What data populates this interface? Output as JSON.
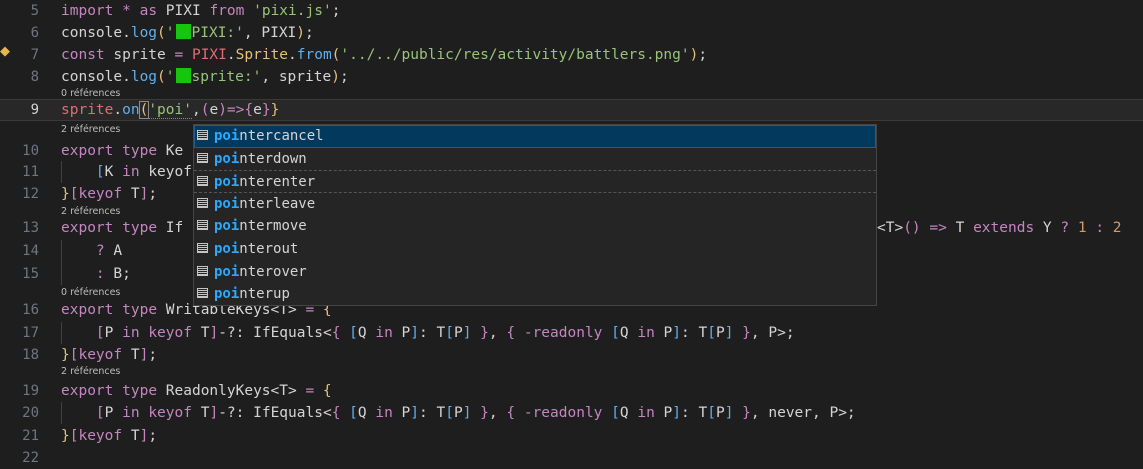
{
  "editor": {
    "lines": [
      {
        "num": "5",
        "tokens": [
          [
            "kw",
            "import"
          ],
          [
            "plain",
            " "
          ],
          [
            "kw",
            "*"
          ],
          [
            "plain",
            " "
          ],
          [
            "kw",
            "as"
          ],
          [
            "plain",
            " PIXI "
          ],
          [
            "kw",
            "from"
          ],
          [
            "plain",
            " "
          ],
          [
            "str",
            "'pixi.js'"
          ],
          [
            "plain",
            ";"
          ]
        ]
      },
      {
        "num": "6",
        "tokens": [
          [
            "plain",
            "console"
          ],
          [
            "plain",
            "."
          ],
          [
            "fn",
            "log"
          ],
          [
            "br1",
            "("
          ],
          [
            "str",
            "'"
          ],
          [
            "sq",
            ""
          ],
          [
            "str",
            "PIXI:'"
          ],
          [
            "plain",
            ", PIXI"
          ],
          [
            "br1",
            ")"
          ],
          [
            "plain",
            ";"
          ]
        ]
      },
      {
        "num": "7",
        "tokens": [
          [
            "kw",
            "const"
          ],
          [
            "plain",
            " sprite "
          ],
          [
            "kw",
            "="
          ],
          [
            "plain",
            " "
          ],
          [
            "pix",
            "PIXI"
          ],
          [
            "plain",
            "."
          ],
          [
            "cls",
            "Sprite"
          ],
          [
            "plain",
            "."
          ],
          [
            "fn",
            "from"
          ],
          [
            "br1",
            "("
          ],
          [
            "str",
            "'../../public/res/activity/battlers.png'"
          ],
          [
            "br1",
            ")"
          ],
          [
            "plain",
            ";"
          ]
        ]
      },
      {
        "num": "8",
        "tokens": [
          [
            "plain",
            "console"
          ],
          [
            "plain",
            "."
          ],
          [
            "fn",
            "log"
          ],
          [
            "br1",
            "("
          ],
          [
            "str",
            "'"
          ],
          [
            "sq",
            ""
          ],
          [
            "str",
            "sprite:'"
          ],
          [
            "plain",
            ", sprite"
          ],
          [
            "br1",
            ")"
          ],
          [
            "plain",
            ";"
          ]
        ]
      },
      {
        "num": "9",
        "tokens": [
          [
            "pix",
            "sprite"
          ],
          [
            "plain",
            "."
          ],
          [
            "fn",
            "on"
          ],
          [
            "br1b",
            "("
          ],
          [
            "str",
            "'poi'"
          ],
          [
            "plain",
            ","
          ],
          [
            "br2",
            "("
          ],
          [
            "plain",
            "e"
          ],
          [
            "br2",
            ")"
          ],
          [
            "kw",
            "=>"
          ],
          [
            "br2",
            "{"
          ],
          [
            "plain",
            "e"
          ],
          [
            "br2",
            "}"
          ],
          [
            "br1",
            "}"
          ]
        ]
      },
      {
        "num": "10",
        "tokens": [
          [
            "kw",
            "export"
          ],
          [
            "plain",
            " "
          ],
          [
            "kw",
            "type"
          ],
          [
            "plain",
            " Ke"
          ]
        ]
      },
      {
        "num": "11",
        "tokens": [
          [
            "plain",
            "    "
          ],
          [
            "br3",
            "["
          ],
          [
            "plain",
            "K "
          ],
          [
            "kw",
            "in"
          ],
          [
            "plain",
            " keyof"
          ]
        ]
      },
      {
        "num": "12",
        "tokens": [
          [
            "br1",
            "}"
          ],
          [
            "br2",
            "["
          ],
          [
            "kw",
            "keyof"
          ],
          [
            "plain",
            " T"
          ],
          [
            "br2",
            "]"
          ],
          [
            "plain",
            ";"
          ]
        ]
      },
      {
        "num": "13",
        "tokens": [
          [
            "kw",
            "export"
          ],
          [
            "plain",
            " "
          ],
          [
            "kw",
            "type"
          ],
          [
            "plain",
            " If"
          ]
        ]
      },
      {
        "num": "14",
        "tokens": [
          [
            "plain",
            "    "
          ],
          [
            "kw",
            "?"
          ],
          [
            "plain",
            " A"
          ]
        ]
      },
      {
        "num": "15",
        "tokens": [
          [
            "plain",
            "    "
          ],
          [
            "kw",
            ":"
          ],
          [
            "plain",
            " B;"
          ]
        ]
      },
      {
        "num": "16",
        "tokens": [
          [
            "kw",
            "export"
          ],
          [
            "plain",
            " "
          ],
          [
            "kw",
            "type"
          ],
          [
            "plain",
            " WritableKeys<T> "
          ],
          [
            "kw",
            "="
          ],
          [
            "plain",
            " "
          ],
          [
            "br1",
            "{"
          ]
        ]
      },
      {
        "num": "17",
        "tokens": [
          [
            "plain",
            "    "
          ],
          [
            "br2",
            "["
          ],
          [
            "plain",
            "P "
          ],
          [
            "kw",
            "in"
          ],
          [
            "plain",
            " "
          ],
          [
            "kw",
            "keyof"
          ],
          [
            "plain",
            " T"
          ],
          [
            "br2",
            "]"
          ],
          [
            "plain",
            "-?: IfEquals<"
          ],
          [
            "br2",
            "{"
          ],
          [
            "plain",
            " "
          ],
          [
            "br3",
            "["
          ],
          [
            "plain",
            "Q "
          ],
          [
            "kw",
            "in"
          ],
          [
            "plain",
            " P"
          ],
          [
            "br3",
            "]"
          ],
          [
            "plain",
            ": T"
          ],
          [
            "br3",
            "["
          ],
          [
            "plain",
            "P"
          ],
          [
            "br3",
            "]"
          ],
          [
            "plain",
            " "
          ],
          [
            "br2",
            "}"
          ],
          [
            "plain",
            ", "
          ],
          [
            "br2",
            "{"
          ],
          [
            "plain",
            " "
          ],
          [
            "kw",
            "-readonly"
          ],
          [
            "plain",
            " "
          ],
          [
            "br3",
            "["
          ],
          [
            "plain",
            "Q "
          ],
          [
            "kw",
            "in"
          ],
          [
            "plain",
            " P"
          ],
          [
            "br3",
            "]"
          ],
          [
            "plain",
            ": T"
          ],
          [
            "br3",
            "["
          ],
          [
            "plain",
            "P"
          ],
          [
            "br3",
            "]"
          ],
          [
            "plain",
            " "
          ],
          [
            "br2",
            "}"
          ],
          [
            "plain",
            ", P>;"
          ]
        ]
      },
      {
        "num": "18",
        "tokens": [
          [
            "br1",
            "}"
          ],
          [
            "br2",
            "["
          ],
          [
            "kw",
            "keyof"
          ],
          [
            "plain",
            " T"
          ],
          [
            "br2",
            "]"
          ],
          [
            "plain",
            ";"
          ]
        ]
      },
      {
        "num": "19",
        "tokens": [
          [
            "kw",
            "export"
          ],
          [
            "plain",
            " "
          ],
          [
            "kw",
            "type"
          ],
          [
            "plain",
            " ReadonlyKeys<T> "
          ],
          [
            "kw",
            "="
          ],
          [
            "plain",
            " "
          ],
          [
            "br1",
            "{"
          ]
        ]
      },
      {
        "num": "20",
        "tokens": [
          [
            "plain",
            "    "
          ],
          [
            "br2",
            "["
          ],
          [
            "plain",
            "P "
          ],
          [
            "kw",
            "in"
          ],
          [
            "plain",
            " "
          ],
          [
            "kw",
            "keyof"
          ],
          [
            "plain",
            " T"
          ],
          [
            "br2",
            "]"
          ],
          [
            "plain",
            "-?: IfEquals<"
          ],
          [
            "br2",
            "{"
          ],
          [
            "plain",
            " "
          ],
          [
            "br3",
            "["
          ],
          [
            "plain",
            "Q "
          ],
          [
            "kw",
            "in"
          ],
          [
            "plain",
            " P"
          ],
          [
            "br3",
            "]"
          ],
          [
            "plain",
            ": T"
          ],
          [
            "br3",
            "["
          ],
          [
            "plain",
            "P"
          ],
          [
            "br3",
            "]"
          ],
          [
            "plain",
            " "
          ],
          [
            "br2",
            "}"
          ],
          [
            "plain",
            ", "
          ],
          [
            "br2",
            "{"
          ],
          [
            "plain",
            " "
          ],
          [
            "kw",
            "-readonly"
          ],
          [
            "plain",
            " "
          ],
          [
            "br3",
            "["
          ],
          [
            "plain",
            "Q "
          ],
          [
            "kw",
            "in"
          ],
          [
            "plain",
            " P"
          ],
          [
            "br3",
            "]"
          ],
          [
            "plain",
            ": T"
          ],
          [
            "br3",
            "["
          ],
          [
            "plain",
            "P"
          ],
          [
            "br3",
            "]"
          ],
          [
            "plain",
            " "
          ],
          [
            "br2",
            "}"
          ],
          [
            "plain",
            ", never, P>;"
          ]
        ]
      },
      {
        "num": "21",
        "tokens": [
          [
            "br1",
            "}"
          ],
          [
            "br2",
            "["
          ],
          [
            "kw",
            "keyof"
          ],
          [
            "plain",
            " T"
          ],
          [
            "br2",
            "]"
          ],
          [
            "plain",
            ";"
          ]
        ]
      },
      {
        "num": "22",
        "tokens": []
      }
    ],
    "line13_tail": [
      [
        "plain",
        "<T>"
      ],
      [
        "br2",
        "()"
      ],
      [
        "plain",
        " "
      ],
      [
        "kw",
        "=>"
      ],
      [
        "plain",
        " T "
      ],
      [
        "kw",
        "extends"
      ],
      [
        "plain",
        " Y "
      ],
      [
        "kw",
        "?"
      ],
      [
        "plain",
        " "
      ],
      [
        "num",
        "1"
      ],
      [
        "plain",
        " "
      ],
      [
        "kw",
        ":"
      ],
      [
        "plain",
        " "
      ],
      [
        "num",
        "2"
      ]
    ],
    "codelens": {
      "refs0": "0 références",
      "refs2": "2 références"
    }
  },
  "suggest": {
    "match": "po",
    "items": [
      {
        "match": "poi",
        "rest": "ntercancel"
      },
      {
        "match": "poi",
        "rest": "nterdown"
      },
      {
        "match": "poi",
        "rest": "nterenter"
      },
      {
        "match": "poi",
        "rest": "nterleave"
      },
      {
        "match": "poi",
        "rest": "ntermove"
      },
      {
        "match": "poi",
        "rest": "nterout"
      },
      {
        "match": "poi",
        "rest": "nterover"
      },
      {
        "match": "poi",
        "rest": "nterup"
      }
    ]
  },
  "colors": {
    "background": "#1e1e1e",
    "keyword": "#c586c0",
    "function": "#61afef",
    "string": "#98c379",
    "match_highlight": "#2aaaff",
    "selected_item": "#04395e"
  },
  "icons": {
    "gutter": "lightbulb-icon",
    "suggest_item": "text-symbol-icon"
  }
}
